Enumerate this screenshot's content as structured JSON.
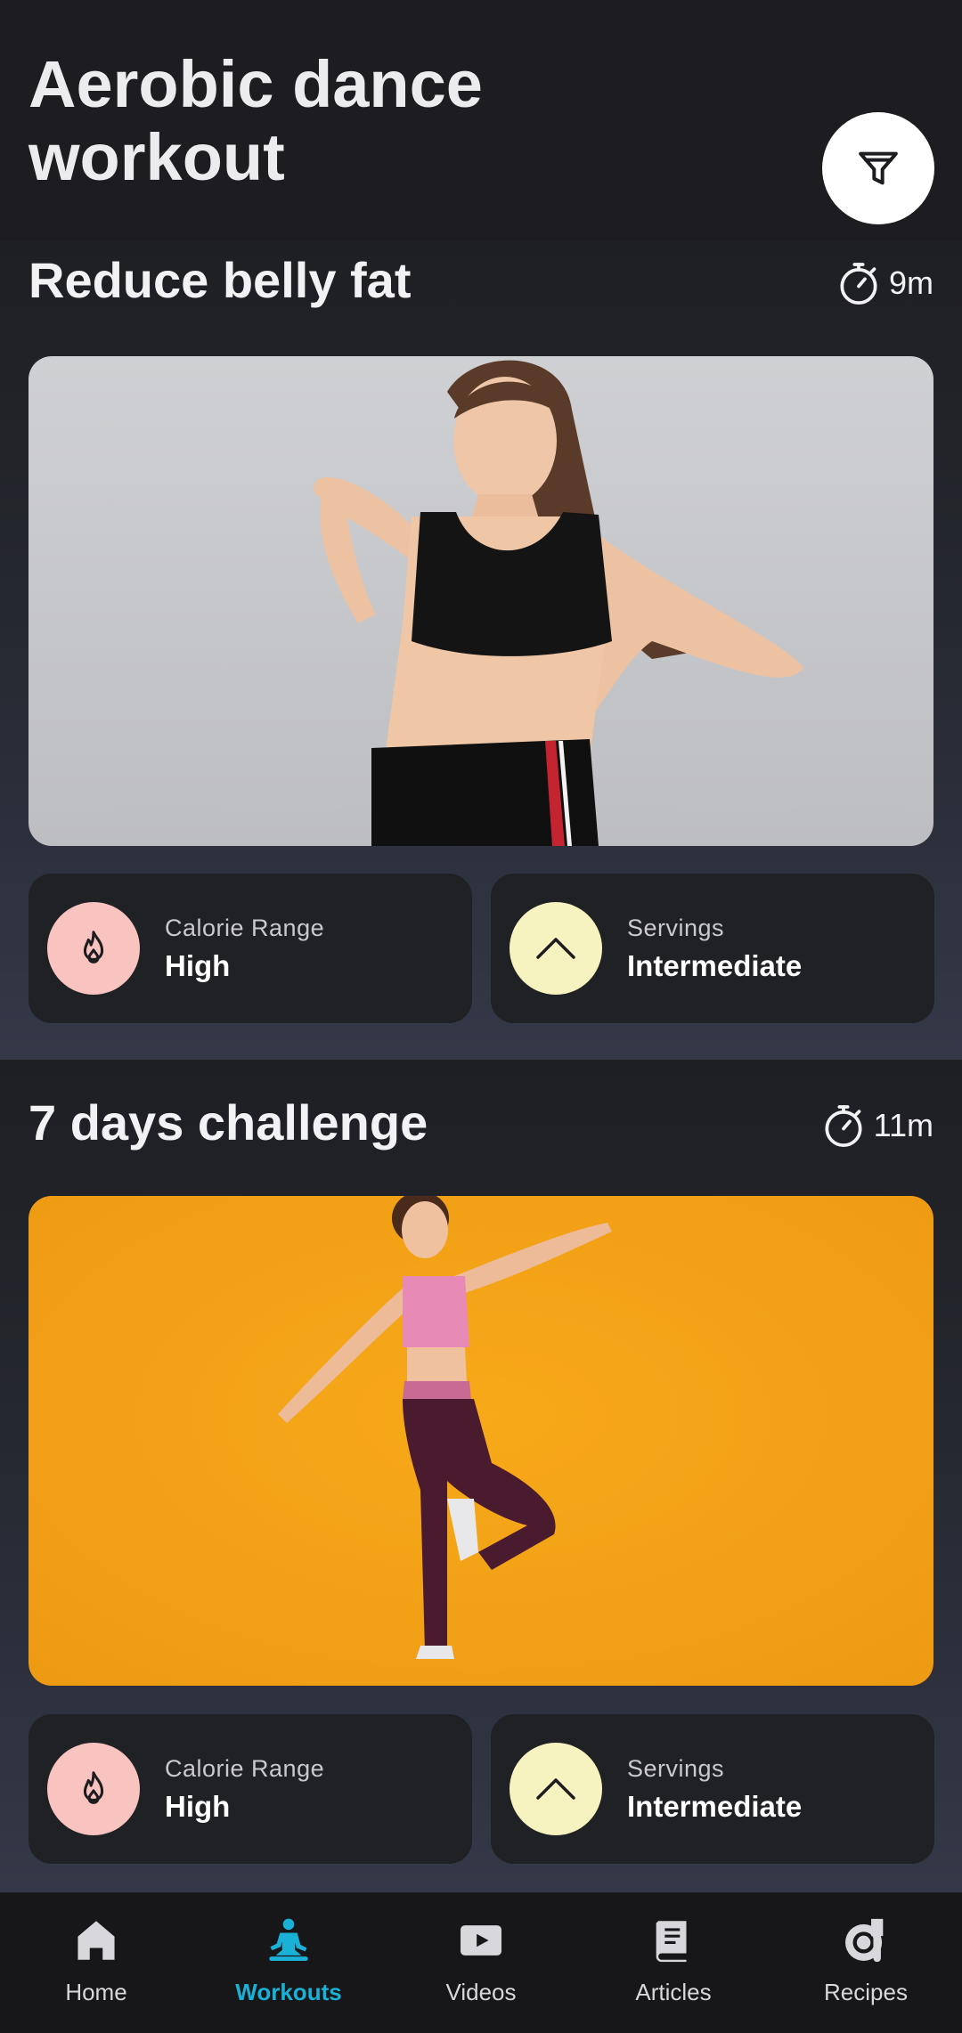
{
  "page": {
    "title_line1": "Aerobic dance",
    "title_line2": "workout"
  },
  "filter": {
    "icon": "filter-icon"
  },
  "workouts": [
    {
      "title": "Reduce belly fat",
      "duration": "9m",
      "image_alt": "woman in black crop top pointing at belly",
      "stats": [
        {
          "label": "Calorie Range",
          "value": "High",
          "icon": "flame-icon",
          "color": "#f9c3c0"
        },
        {
          "label": "Servings",
          "value": "Intermediate",
          "icon": "chevron-up-icon",
          "color": "#f7f3c0"
        }
      ]
    },
    {
      "title": "7 days challenge",
      "duration": "11m",
      "image_alt": "woman dancing on orange background",
      "stats": [
        {
          "label": "Calorie Range",
          "value": "High",
          "icon": "flame-icon",
          "color": "#f9c3c0"
        },
        {
          "label": "Servings",
          "value": "Intermediate",
          "icon": "chevron-up-icon",
          "color": "#f7f3c0"
        }
      ]
    }
  ],
  "nav": {
    "items": [
      {
        "label": "Home",
        "icon": "home-icon",
        "active": false
      },
      {
        "label": "Workouts",
        "icon": "meditation-icon",
        "active": true
      },
      {
        "label": "Videos",
        "icon": "play-icon",
        "active": false
      },
      {
        "label": "Articles",
        "icon": "book-icon",
        "active": false
      },
      {
        "label": "Recipes",
        "icon": "recipe-icon",
        "active": false
      }
    ],
    "active_color": "#1ab1d6"
  }
}
